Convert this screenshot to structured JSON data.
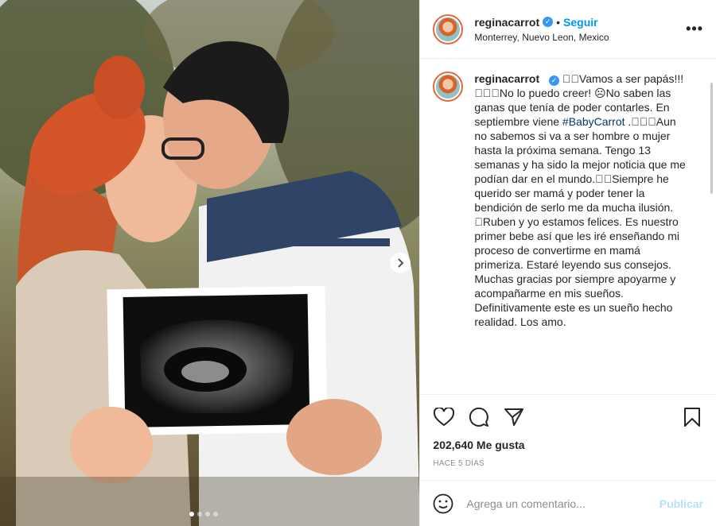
{
  "post": {
    "username": "reginacarrot",
    "follow_label": "Seguir",
    "separator": "•",
    "location": "Monterrey, Nuevo Leon, Mexico",
    "more_label": "•••",
    "verified_mark": "✓"
  },
  "caption": {
    "part1": "􏿾􏿾Vamos a ser papás!!!􏿾􏿾􏿾No lo puedo creer! ☹No saben las ganas que tenía de poder contarles. En septiembre viene ",
    "hashtag": "#BabyCarrot",
    "part2": " .􏿾􏿾􏿾Aun no sabemos si va a ser hombre o mujer hasta la próxima semana. Tengo 13 semanas y ha sido la mejor noticia que me podían dar en el mundo.􏿾􏿾Siempre he querido ser mamá y poder tener la bendición de serlo me da mucha ilusión. 􏿾Ruben y yo estamos felices. Es nuestro primer bebe así que les iré enseñando mi proceso de convertirme en mamá primeriza. Estaré leyendo sus consejos. Muchas gracias por siempre apoyarme y acompañarme en mis sueños. Definitivamente este es un sueño hecho realidad. Los amo."
  },
  "stats": {
    "likes": "202,640 Me gusta",
    "time": "HACE 5 DÍAS"
  },
  "comment": {
    "placeholder": "Agrega un comentario...",
    "publish_label": "Publicar"
  },
  "icons": {
    "like": "heart-icon",
    "comment": "comment-icon",
    "share": "paper-plane-icon",
    "save": "bookmark-icon",
    "emoji": "smiley-icon",
    "next": "chevron-right-icon"
  },
  "colors": {
    "accent": "#0095f6",
    "verified": "#3897f0",
    "hashtag": "#00376b",
    "publish_disabled": "#b2dffc"
  }
}
